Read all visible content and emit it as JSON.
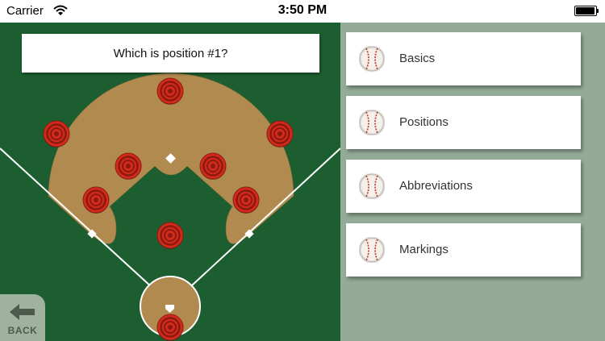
{
  "status_bar": {
    "carrier": "Carrier",
    "time": "3:50 PM",
    "wifi_icon": "wifi-icon",
    "battery_icon": "battery-icon"
  },
  "quiz": {
    "question": "Which is position #1?"
  },
  "back_button": {
    "label": "BACK",
    "icon": "arrow-left-icon"
  },
  "menu": {
    "items": [
      {
        "label": "Basics",
        "icon": "baseball-icon"
      },
      {
        "label": "Positions",
        "icon": "baseball-icon"
      },
      {
        "label": "Abbreviations",
        "icon": "baseball-icon"
      },
      {
        "label": "Markings",
        "icon": "baseball-icon"
      }
    ]
  },
  "colors": {
    "field_grass": "#1c5e30",
    "infield_dirt": "#b08a4e",
    "menu_background": "#93ab97",
    "target_red": "#d42a1c"
  }
}
